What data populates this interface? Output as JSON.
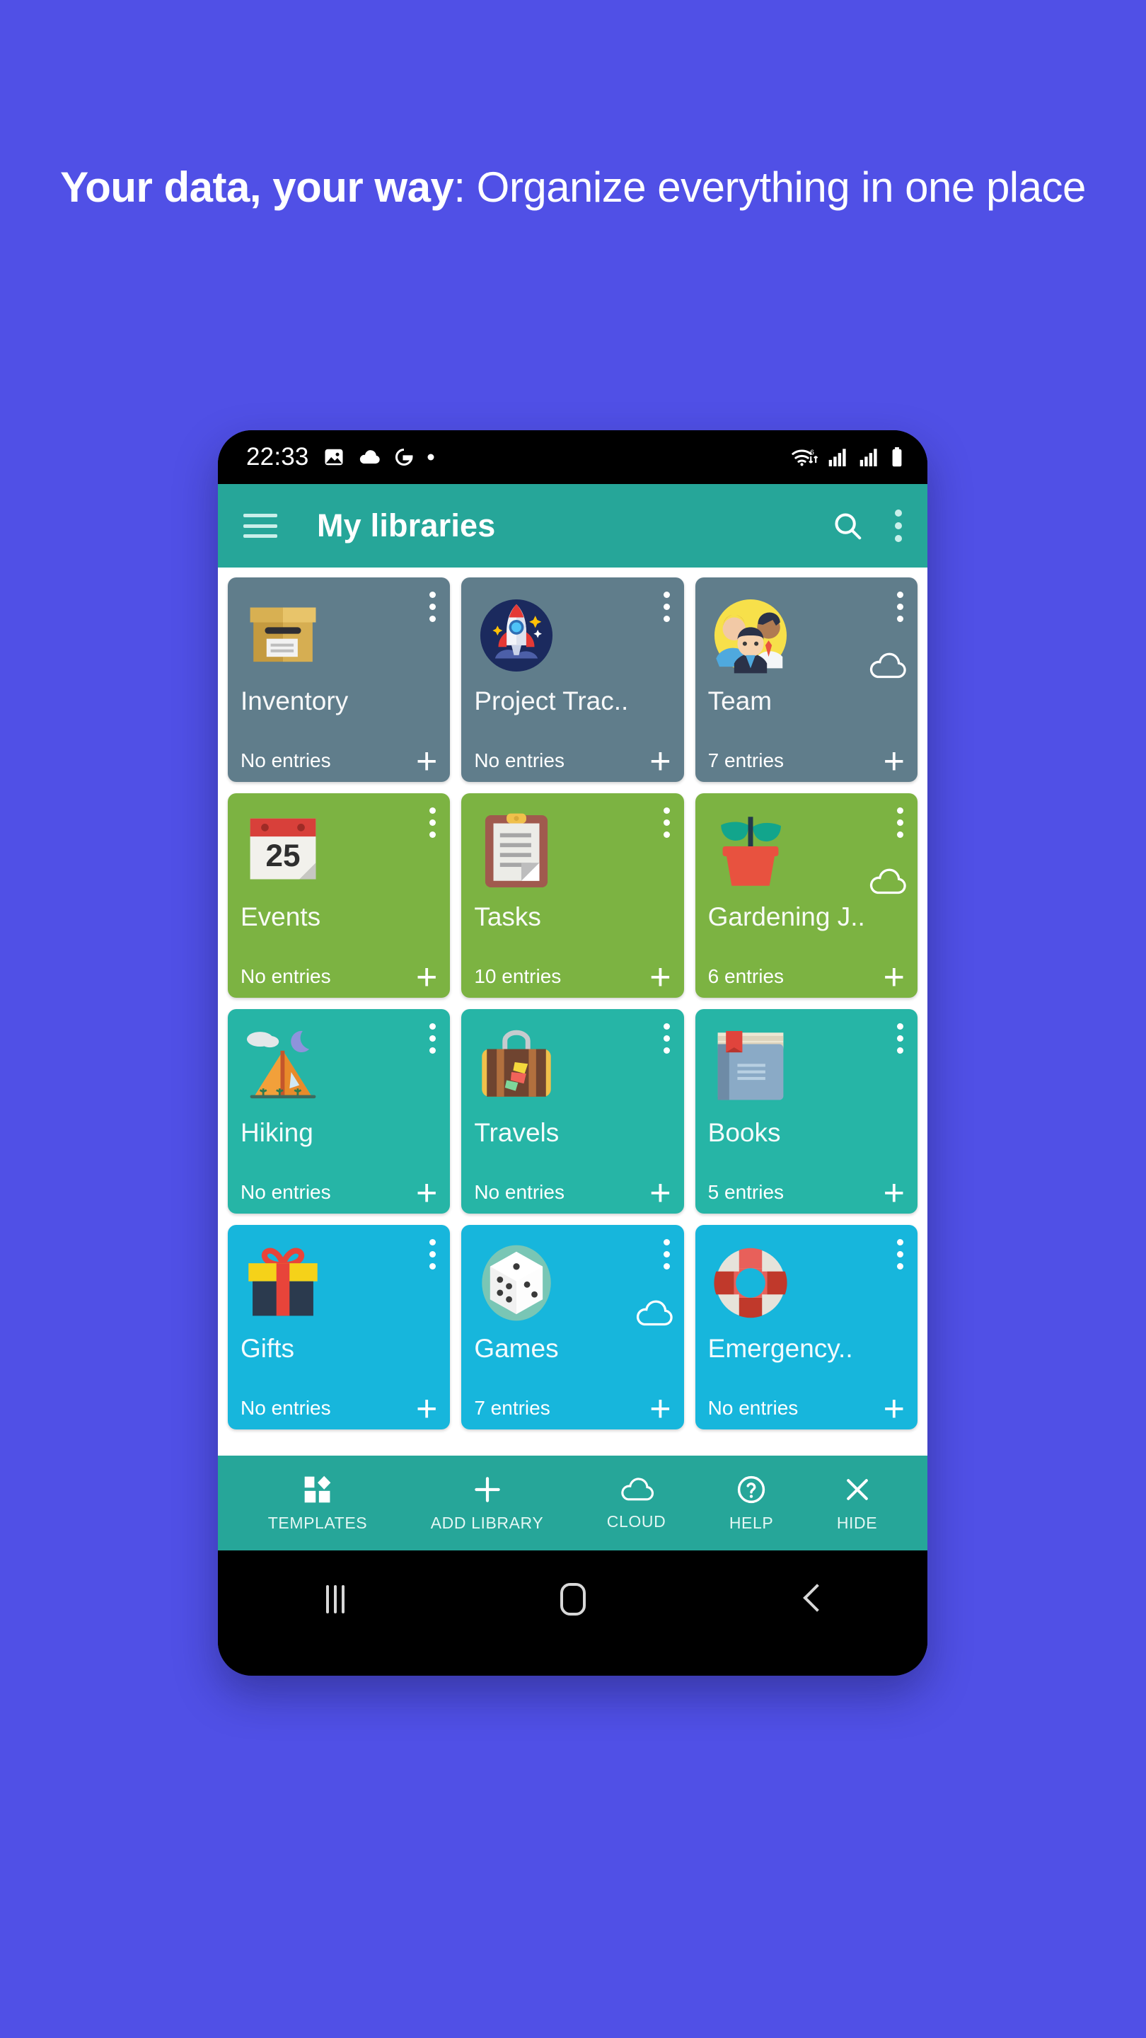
{
  "promo": {
    "headline_bold": "Your data, your way",
    "headline_rest": ": Organize everything in one place",
    "background_color": "#5050E6"
  },
  "status_bar": {
    "time": "22:33",
    "left_icons": [
      "image-icon",
      "cloud-icon",
      "google-g-icon",
      "dot-icon"
    ],
    "right_icons": [
      "wifi-6-icon",
      "signal-icon",
      "signal-icon",
      "battery-icon"
    ]
  },
  "app_bar": {
    "menu_icon": "hamburger-icon",
    "title": "My libraries",
    "search_icon": "search-icon",
    "overflow_icon": "more-vert-icon",
    "color": "#26A699"
  },
  "libraries": [
    {
      "title": "Inventory",
      "entries": "No entries",
      "color": "#607D8B",
      "icon": "box-icon",
      "cloud": false,
      "add_icon": "plus-icon",
      "menu_icon": "more-vert-icon"
    },
    {
      "title": "Project Trac..",
      "entries": "No entries",
      "color": "#607D8B",
      "icon": "rocket-icon",
      "cloud": false,
      "add_icon": "plus-icon",
      "menu_icon": "more-vert-icon"
    },
    {
      "title": "Team",
      "entries": "7 entries",
      "color": "#607D8B",
      "icon": "people-icon",
      "cloud": true,
      "add_icon": "plus-icon",
      "menu_icon": "more-vert-icon"
    },
    {
      "title": "Events",
      "entries": "No entries",
      "color": "#7CB342",
      "icon": "calendar-icon",
      "cloud": false,
      "add_icon": "plus-icon",
      "menu_icon": "more-vert-icon"
    },
    {
      "title": "Tasks",
      "entries": "10 entries",
      "color": "#7CB342",
      "icon": "clipboard-icon",
      "cloud": false,
      "add_icon": "plus-icon",
      "menu_icon": "more-vert-icon"
    },
    {
      "title": "Gardening J..",
      "entries": "6 entries",
      "color": "#7CB342",
      "icon": "plant-icon",
      "cloud": true,
      "add_icon": "plus-icon",
      "menu_icon": "more-vert-icon"
    },
    {
      "title": "Hiking",
      "entries": "No entries",
      "color": "#26B5A6",
      "icon": "tent-icon",
      "cloud": false,
      "add_icon": "plus-icon",
      "menu_icon": "more-vert-icon"
    },
    {
      "title": "Travels",
      "entries": "No entries",
      "color": "#26B5A6",
      "icon": "suitcase-icon",
      "cloud": false,
      "add_icon": "plus-icon",
      "menu_icon": "more-vert-icon"
    },
    {
      "title": "Books",
      "entries": "5 entries",
      "color": "#26B5A6",
      "icon": "book-icon",
      "cloud": false,
      "add_icon": "plus-icon",
      "menu_icon": "more-vert-icon"
    },
    {
      "title": "Gifts",
      "entries": "No entries",
      "color": "#17B6DC",
      "icon": "gift-icon",
      "cloud": false,
      "add_icon": "plus-icon",
      "menu_icon": "more-vert-icon"
    },
    {
      "title": "Games",
      "entries": "7 entries",
      "color": "#17B6DC",
      "icon": "dice-icon",
      "cloud": true,
      "add_icon": "plus-icon",
      "menu_icon": "more-vert-icon"
    },
    {
      "title": "Emergency..",
      "entries": "No entries",
      "color": "#17B6DC",
      "icon": "lifebuoy-icon",
      "cloud": false,
      "add_icon": "plus-icon",
      "menu_icon": "more-vert-icon"
    }
  ],
  "bottom_bar": {
    "items": [
      {
        "label": "TEMPLATES",
        "icon": "templates-icon"
      },
      {
        "label": "ADD LIBRARY",
        "icon": "plus-icon"
      },
      {
        "label": "CLOUD",
        "icon": "cloud-icon"
      },
      {
        "label": "HELP",
        "icon": "help-circle-icon"
      },
      {
        "label": "HIDE",
        "icon": "close-icon"
      }
    ]
  },
  "nav_bar": {
    "recents": "recents-icon",
    "home": "home-icon",
    "back": "back-icon"
  }
}
